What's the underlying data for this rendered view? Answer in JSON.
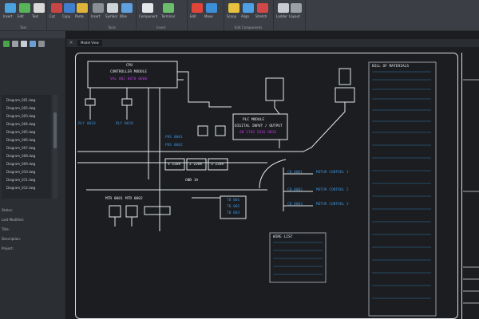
{
  "ribbon": {
    "groups": [
      {
        "label": "Text",
        "buttons": [
          "Insert",
          "Edit",
          "Text"
        ]
      },
      {
        "label": "",
        "buttons": [
          "Cut",
          "Copy",
          "Paste"
        ]
      },
      {
        "label": "Tools",
        "buttons": [
          "Insert",
          "Symbol",
          "Wire"
        ]
      },
      {
        "label": "Insert",
        "buttons": [
          "Component",
          "Terminal"
        ]
      },
      {
        "label": "",
        "buttons": [
          "Edit",
          "Move"
        ]
      },
      {
        "label": "Edit Components",
        "buttons": [
          "Scoop",
          "Align",
          "Stretch"
        ]
      },
      {
        "label": "",
        "buttons": [
          "Ladder",
          "Layout"
        ]
      }
    ]
  },
  "left_panel": {
    "tree_items": [
      "Diagram_001.dwg",
      "Diagram_002.dwg",
      "Diagram_003.dwg",
      "Diagram_004.dwg",
      "Diagram_005.dwg",
      "Diagram_006.dwg",
      "Diagram_007.dwg",
      "Diagram_008.dwg",
      "Diagram_009.dwg",
      "Diagram_010.dwg",
      "Diagram_011.dwg",
      "Diagram_012.dwg"
    ],
    "details": [
      "Status:",
      "Last Modified:",
      "Title:",
      "Description:",
      "Project:"
    ]
  },
  "canvas": {
    "tab_label": "Model View"
  },
  "schematic": {
    "top_box_title": "CPU",
    "top_box_line1": "CONTROLLER MODULE",
    "top_box_line2": "VAL 002 0070 0800",
    "relay_labels": [
      "RLY 0010",
      "RLY 0020"
    ],
    "module_right_title": "PLC MODULE",
    "module_right_line1": "DIGITAL INPUT / OUTPUT",
    "module_right_line2": "AB 1769 IQ16 OB16",
    "sensor_tags": [
      "PRS 0001",
      "PRS 0002"
    ],
    "wire_tags": [
      "1 220V",
      "2 220V",
      "3 220V"
    ],
    "ground_label": "GND 1A",
    "bottom_tags": [
      "MTR 0001",
      "MTR 0002"
    ],
    "terminal_block": [
      "TB 001",
      "TB 002",
      "TB 003"
    ],
    "right_tags": [
      "CB 0001",
      "CB 0002",
      "CB 0003"
    ],
    "right_tag_desc": [
      "MOTOR CONTROL 1",
      "MOTOR CONTROL 2",
      "MOTOR CONTROL 3"
    ],
    "table_small_header": "WIRE LIST",
    "bom_header": "BILL OF MATERIALS"
  },
  "colors": {
    "wire": "#e6e9ec",
    "tag_blue": "#3a8fd8",
    "tag_magenta": "#b53cd8"
  }
}
